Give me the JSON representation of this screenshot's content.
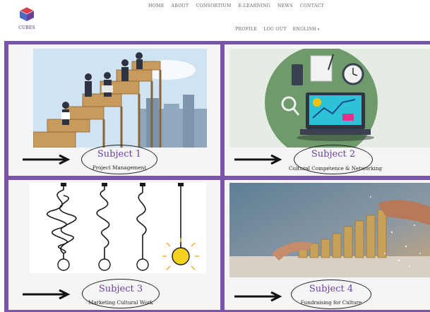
{
  "brand": {
    "name": "CUBES"
  },
  "nav": {
    "main": [
      {
        "label": "HOME"
      },
      {
        "label": "ABOUT"
      },
      {
        "label": "CONSORTIUM"
      },
      {
        "label": "E-LEARNING"
      },
      {
        "label": "NEWS"
      },
      {
        "label": "CONTACT"
      }
    ],
    "user": [
      {
        "label": "PROFILE"
      },
      {
        "label": "LOG OUT"
      },
      {
        "label": "ENGLISH"
      }
    ]
  },
  "colors": {
    "accent": "#7a54a7",
    "title": "#6b3fa0"
  },
  "subjects": [
    {
      "title": "Subject 1",
      "desc": "Project Management",
      "icon": "stairs-teamwork-illustration"
    },
    {
      "title": "Subject 2",
      "desc": "Cultural Competence & Networking",
      "icon": "laptop-desk-illustration"
    },
    {
      "title": "Subject 3",
      "desc": "Marketing Cultural Work",
      "icon": "lightbulb-tangle-illustration"
    },
    {
      "title": "Subject 4",
      "desc": "Fundraising for Culture",
      "icon": "coins-growth-photo"
    }
  ]
}
